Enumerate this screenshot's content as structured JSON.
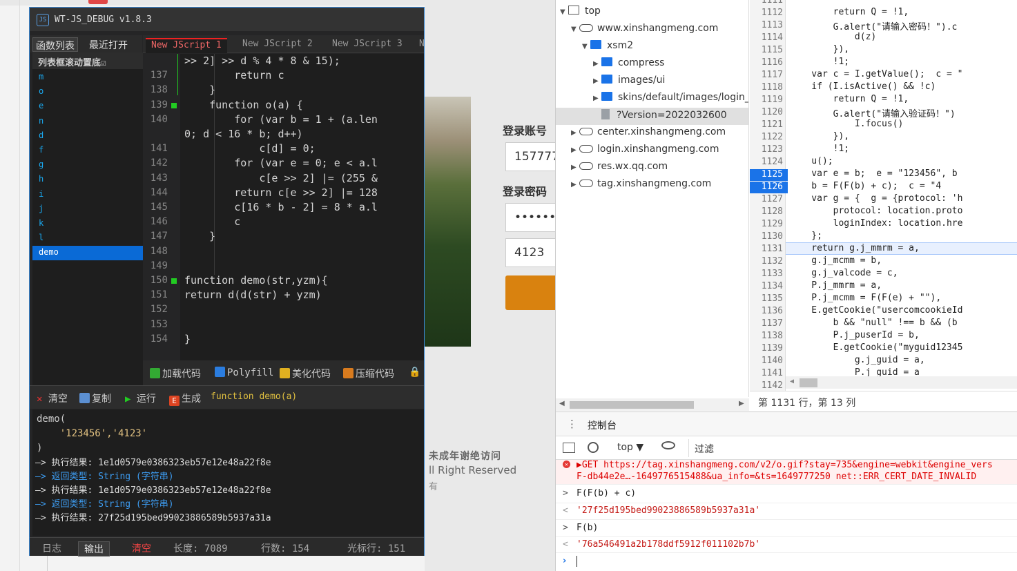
{
  "wt": {
    "title": "WT-JS_DEBUG v1.8.3",
    "left_tabs": [
      "函数列表",
      "最近打开"
    ],
    "func_header": "列表框滚动置底☑",
    "functions": [
      "m",
      "o",
      "e",
      "n",
      "d",
      "f",
      "g",
      "h",
      "i",
      "j",
      "k",
      "l",
      "demo"
    ],
    "script_tabs": [
      "New JScript 1",
      "New JScript 2",
      "New JScript 3",
      "N"
    ],
    "code_lines": [
      {
        "n": "",
        "t": ">> 2] >> d % 4 * 8 & 15);"
      },
      {
        "n": "137",
        "t": "        return c"
      },
      {
        "n": "138",
        "t": "    }"
      },
      {
        "n": "139",
        "t": "    function o(a) {"
      },
      {
        "n": "140",
        "t": "        for (var b = 1 + (a.len"
      },
      {
        "n": "",
        "t": "0; d < 16 * b; d++)"
      },
      {
        "n": "141",
        "t": "            c[d] = 0;"
      },
      {
        "n": "142",
        "t": "        for (var e = 0; e < a.l"
      },
      {
        "n": "143",
        "t": "            c[e >> 2] |= (255 &"
      },
      {
        "n": "144",
        "t": "        return c[e >> 2] |= 128"
      },
      {
        "n": "145",
        "t": "        c[16 * b - 2] = 8 * a.l"
      },
      {
        "n": "146",
        "t": "        c"
      },
      {
        "n": "147",
        "t": "    }"
      },
      {
        "n": "148",
        "t": ""
      },
      {
        "n": "149",
        "t": ""
      },
      {
        "n": "150",
        "t": "function demo(str,yzm){"
      },
      {
        "n": "151",
        "t": "return d(d(str) + yzm)"
      },
      {
        "n": "152",
        "t": ""
      },
      {
        "n": "153",
        "t": ""
      },
      {
        "n": "154",
        "t": "}"
      }
    ],
    "toolbar": [
      "加载代码",
      "Polyfill",
      "美化代码",
      "压缩代码",
      "🔒"
    ],
    "runbar": {
      "clear": "清空",
      "copy": "复制",
      "run": "运行",
      "gen": "生成",
      "sig": "function demo(a)"
    },
    "call": {
      "line1": "demo(",
      "line2": "    '123456','4123'",
      "line3": ")"
    },
    "output": [
      {
        "cls": "",
        "t": "—> 执行结果: 1e1d0579e0386323eb57e12e48a22f8e"
      },
      {
        "cls": "oblue",
        "t": "—> 返回类型: String (字符串)"
      },
      {
        "cls": "",
        "t": "—> 执行结果: 1e1d0579e0386323eb57e12e48a22f8e"
      },
      {
        "cls": "oblue",
        "t": "—> 返回类型: String (字符串)"
      },
      {
        "cls": "",
        "t": "—> 执行结果: 27f25d195bed99023886589b5937a31a"
      }
    ],
    "status": {
      "log": "日志",
      "out": "输出",
      "clear": "清空",
      "len": "长度: 7089",
      "lines": "行数: 154",
      "cursor": "光标行: 151"
    }
  },
  "login": {
    "account_label": "登录账号",
    "account_value": "157777",
    "password_label": "登录密码",
    "password_value": "••••••",
    "captcha_value": "4123",
    "footer1": "未成年谢绝访问",
    "footer2": "ll Right Reserved",
    "footer3": "有"
  },
  "devtools": {
    "tree": [
      {
        "indent": 0,
        "arrow": "▼",
        "icon": "frame",
        "label": "top",
        "sel": false
      },
      {
        "indent": 1,
        "arrow": "▼",
        "icon": "cloud",
        "label": "www.xinshangmeng.com",
        "sel": false
      },
      {
        "indent": 2,
        "arrow": "▼",
        "icon": "folder",
        "label": "xsm2",
        "sel": false
      },
      {
        "indent": 3,
        "arrow": "▶",
        "icon": "folder",
        "label": "compress",
        "sel": false
      },
      {
        "indent": 3,
        "arrow": "▶",
        "icon": "folder",
        "label": "images/ui",
        "sel": false
      },
      {
        "indent": 3,
        "arrow": "▶",
        "icon": "folder",
        "label": "skins/default/images/login_r",
        "sel": false
      },
      {
        "indent": 3,
        "arrow": "",
        "icon": "file",
        "label": "?Version=2022032600",
        "sel": true
      },
      {
        "indent": 1,
        "arrow": "▶",
        "icon": "cloud",
        "label": "center.xinshangmeng.com",
        "sel": false
      },
      {
        "indent": 1,
        "arrow": "▶",
        "icon": "cloud",
        "label": "login.xinshangmeng.com",
        "sel": false
      },
      {
        "indent": 1,
        "arrow": "▶",
        "icon": "cloud",
        "label": "res.wx.qq.com",
        "sel": false
      },
      {
        "indent": 1,
        "arrow": "▶",
        "icon": "cloud",
        "label": "tag.xinshangmeng.com",
        "sel": false
      }
    ],
    "src_lines": [
      {
        "n": "1111",
        "t": ""
      },
      {
        "n": "1112",
        "t": "        return Q = !1,"
      },
      {
        "n": "1113",
        "t": "        G.alert(\"请输入密码！\").c"
      },
      {
        "n": "1114",
        "t": "            d(z)"
      },
      {
        "n": "1115",
        "t": "        }),"
      },
      {
        "n": "1116",
        "t": "        !1;"
      },
      {
        "n": "1117",
        "t": "    var c = I.getValue();  c = \""
      },
      {
        "n": "1118",
        "t": "    if (I.isActive() && !c)"
      },
      {
        "n": "1119",
        "t": "        return Q = !1,"
      },
      {
        "n": "1120",
        "t": "        G.alert(\"请输入验证码！\")"
      },
      {
        "n": "1121",
        "t": "            I.focus()"
      },
      {
        "n": "1122",
        "t": "        }),"
      },
      {
        "n": "1123",
        "t": "        !1;"
      },
      {
        "n": "1124",
        "t": "    u();"
      },
      {
        "n": "1125",
        "t": "    var e = b;  e = \"123456\", b"
      },
      {
        "n": "1126",
        "t": "    b = F(F(b) + c);  c = \"4"
      },
      {
        "n": "1127",
        "t": "    var g = {  g = {protocol: 'h"
      },
      {
        "n": "1128",
        "t": "        protocol: location.proto"
      },
      {
        "n": "1129",
        "t": "        loginIndex: location.hre"
      },
      {
        "n": "1130",
        "t": "    };"
      },
      {
        "n": "1131",
        "t": "    return g.j_mmrm = a,"
      },
      {
        "n": "1132",
        "t": "    g.j_mcmm = b,"
      },
      {
        "n": "1133",
        "t": "    g.j_valcode = c,"
      },
      {
        "n": "1134",
        "t": "    P.j_mmrm = a,"
      },
      {
        "n": "1135",
        "t": "    P.j_mcmm = F(F(e) + \"\"),"
      },
      {
        "n": "1136",
        "t": "    E.getCookie(\"usercomcookieId"
      },
      {
        "n": "1137",
        "t": "        b && \"null\" !== b && (b"
      },
      {
        "n": "1138",
        "t": "        P.j_puserId = b,"
      },
      {
        "n": "1139",
        "t": "        E.getCookie(\"myguid12345"
      },
      {
        "n": "1140",
        "t": "            g.j_guid = a,"
      },
      {
        "n": "1141",
        "t": "            P.j_guid = a"
      },
      {
        "n": "1142",
        "t": ""
      }
    ],
    "position": "第 1131 行，第 13 列",
    "console_tab": "控制台",
    "context": "top ▼",
    "filter_placeholder": "过滤",
    "error_line1": "▶GET https://tag.xinshangmeng.com/v2/o.gif?stay=735&engine=webkit&engine_vers",
    "error_line2": "F-db44e2e…-1649776515488&ua_info=&ts=1649777250 net::ERR_CERT_DATE_INVALID",
    "cmd1": "F(F(b) + c)",
    "res1": "'27f25d195bed99023886589b5937a31a'",
    "cmd2": "F(b)",
    "res2": "'76a546491a2b178ddf5912f011102b7b'"
  }
}
